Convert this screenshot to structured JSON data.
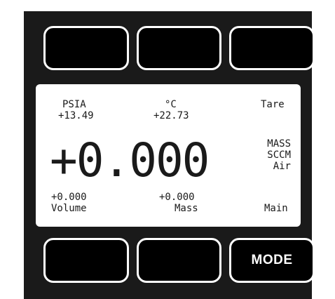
{
  "buttons": {
    "top_left": "",
    "top_center": "",
    "top_right": "",
    "bottom_left": "",
    "bottom_center": "",
    "bottom_right": "MODE"
  },
  "display": {
    "pressure_unit": "PSIA",
    "pressure_value": "+13.49",
    "temp_unit": "°C",
    "temp_value": "+22.73",
    "tare_label": "Tare",
    "main_value": "+0.000",
    "mode_line1": "MASS",
    "mode_line2": "SCCM",
    "mode_line3": "Air",
    "volume_value": "+0.000",
    "volume_label": "Volume",
    "mass_value": "+0.000",
    "mass_label": "Mass",
    "main_label": "Main"
  }
}
